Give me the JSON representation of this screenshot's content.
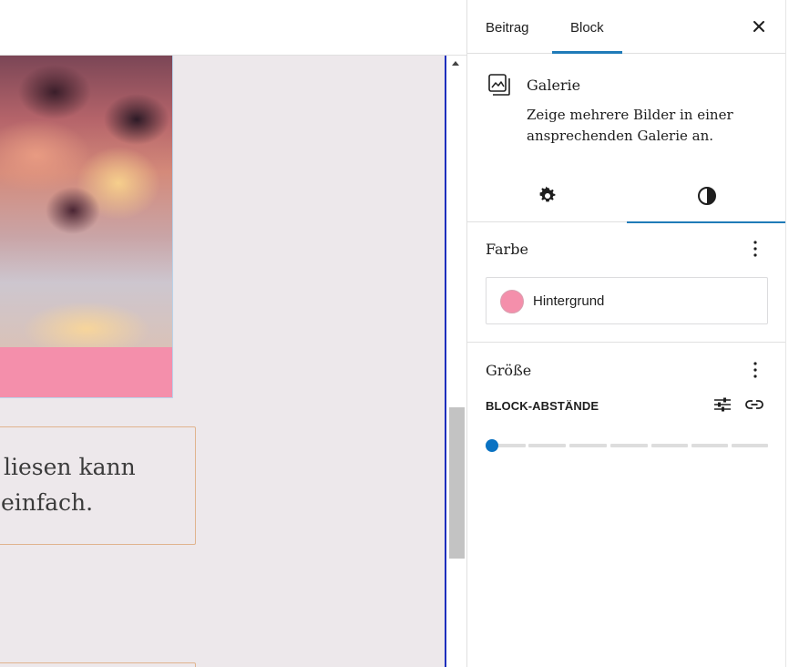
{
  "sidebar": {
    "tabs": [
      {
        "label": "Beitrag",
        "active": false
      },
      {
        "label": "Block",
        "active": true
      }
    ],
    "close_icon": "close-icon",
    "block_card": {
      "icon": "gallery-icon",
      "title": "Galerie",
      "description": "Zeige mehrere Bilder in einer ansprechenden Galerie an."
    },
    "inspector_tabs": [
      {
        "name": "settings",
        "icon": "gear-icon",
        "active": false
      },
      {
        "name": "styles",
        "icon": "half-circle-icon",
        "active": true
      }
    ],
    "color_panel": {
      "title": "Farbe",
      "items": [
        {
          "label": "Hintergrund",
          "swatch": "#f48fab"
        }
      ]
    },
    "size_panel": {
      "title": "Größe",
      "spacing_label": "BLOCK-ABSTÄNDE",
      "spacing_value": 0
    }
  },
  "canvas": {
    "text_lines": [
      "liesen kann",
      "einfach."
    ],
    "gallery_background": "#f48fab"
  },
  "colors": {
    "accent": "#1f7bb8",
    "slider_thumb": "#0a72c2",
    "canvas_bg": "#ede8eb"
  }
}
